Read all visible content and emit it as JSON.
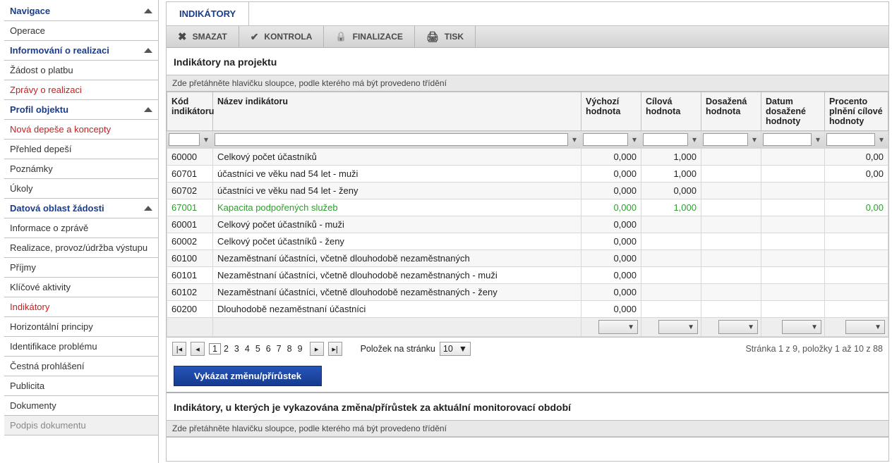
{
  "sidebar": {
    "groups": [
      {
        "label": "Navigace",
        "items": [
          {
            "label": "Operace",
            "style": ""
          }
        ]
      },
      {
        "label": "Informování o realizaci",
        "items": [
          {
            "label": "Žádost o platbu",
            "style": ""
          },
          {
            "label": "Zprávy o realizaci",
            "style": "red"
          }
        ]
      },
      {
        "label": "Profil objektu",
        "items": [
          {
            "label": "Nová depeše a koncepty",
            "style": "red"
          },
          {
            "label": "Přehled depeší",
            "style": ""
          },
          {
            "label": "Poznámky",
            "style": ""
          },
          {
            "label": "Úkoly",
            "style": ""
          }
        ]
      },
      {
        "label": "Datová oblast žádosti",
        "items": [
          {
            "label": "Informace o zprávě",
            "style": ""
          },
          {
            "label": "Realizace, provoz/údržba výstupu",
            "style": ""
          },
          {
            "label": "Příjmy",
            "style": ""
          },
          {
            "label": "Klíčové aktivity",
            "style": ""
          },
          {
            "label": "Indikátory",
            "style": "red"
          },
          {
            "label": "Horizontální principy",
            "style": ""
          },
          {
            "label": "Identifikace problému",
            "style": ""
          },
          {
            "label": "Čestná prohlášení",
            "style": ""
          },
          {
            "label": "Publicita",
            "style": ""
          },
          {
            "label": "Dokumenty",
            "style": ""
          },
          {
            "label": "Podpis dokumentu",
            "style": "disabled"
          }
        ]
      }
    ]
  },
  "tab_label": "INDIKÁTORY",
  "toolbar": {
    "smazat": "SMAZAT",
    "kontrola": "KONTROLA",
    "finalizace": "FINALIZACE",
    "tisk": "TISK"
  },
  "section1_title": "Indikátory na projektu",
  "drag_hint": "Zde přetáhněte hlavičku sloupce, podle kterého má být provedeno třídění",
  "columns": {
    "kod": "Kód indikátoru",
    "nazev": "Název indikátoru",
    "vychozi": "Výchozí hodnota",
    "cilova": "Cílová hodnota",
    "dosazena": "Dosažená hodnota",
    "datum": "Datum dosažené hodnoty",
    "procento": "Procento plnění cílové hodnoty"
  },
  "rows": [
    {
      "kod": "60000",
      "nazev": "Celkový počet účastníků",
      "vychozi": "0,000",
      "cilova": "1,000",
      "dosazena": "",
      "datum": "",
      "proc": "0,00",
      "green": false
    },
    {
      "kod": "60701",
      "nazev": "účastníci ve věku nad 54 let - muži",
      "vychozi": "0,000",
      "cilova": "1,000",
      "dosazena": "",
      "datum": "",
      "proc": "0,00",
      "green": false
    },
    {
      "kod": "60702",
      "nazev": "účastníci ve věku nad 54 let - ženy",
      "vychozi": "0,000",
      "cilova": "0,000",
      "dosazena": "",
      "datum": "",
      "proc": "",
      "green": false
    },
    {
      "kod": "67001",
      "nazev": "Kapacita podpořených služeb",
      "vychozi": "0,000",
      "cilova": "1,000",
      "dosazena": "",
      "datum": "",
      "proc": "0,00",
      "green": true
    },
    {
      "kod": "60001",
      "nazev": "Celkový počet účastníků - muži",
      "vychozi": "0,000",
      "cilova": "",
      "dosazena": "",
      "datum": "",
      "proc": "",
      "green": false
    },
    {
      "kod": "60002",
      "nazev": "Celkový počet účastníků - ženy",
      "vychozi": "0,000",
      "cilova": "",
      "dosazena": "",
      "datum": "",
      "proc": "",
      "green": false
    },
    {
      "kod": "60100",
      "nazev": "Nezaměstnaní účastníci, včetně dlouhodobě nezaměstnaných",
      "vychozi": "0,000",
      "cilova": "",
      "dosazena": "",
      "datum": "",
      "proc": "",
      "green": false
    },
    {
      "kod": "60101",
      "nazev": "Nezaměstnaní účastníci, včetně dlouhodobě nezaměstnaných - muži",
      "vychozi": "0,000",
      "cilova": "",
      "dosazena": "",
      "datum": "",
      "proc": "",
      "green": false
    },
    {
      "kod": "60102",
      "nazev": "Nezaměstnaní účastníci, včetně dlouhodobě nezaměstnaných - ženy",
      "vychozi": "0,000",
      "cilova": "",
      "dosazena": "",
      "datum": "",
      "proc": "",
      "green": false
    },
    {
      "kod": "60200",
      "nazev": "Dlouhodobě nezaměstnaní účastníci",
      "vychozi": "0,000",
      "cilova": "",
      "dosazena": "",
      "datum": "",
      "proc": "",
      "green": false
    }
  ],
  "pager": {
    "pages": [
      "1",
      "2",
      "3",
      "4",
      "5",
      "6",
      "7",
      "8",
      "9"
    ],
    "current": "1",
    "items_label": "Položek na stránku",
    "items_value": "10",
    "status": "Stránka 1 z 9, položky 1 až 10 z 88"
  },
  "action_button": "Vykázat změnu/přírůstek",
  "section2_title": "Indikátory, u kterých je vykazována změna/přírůstek za aktuální monitorovací období"
}
